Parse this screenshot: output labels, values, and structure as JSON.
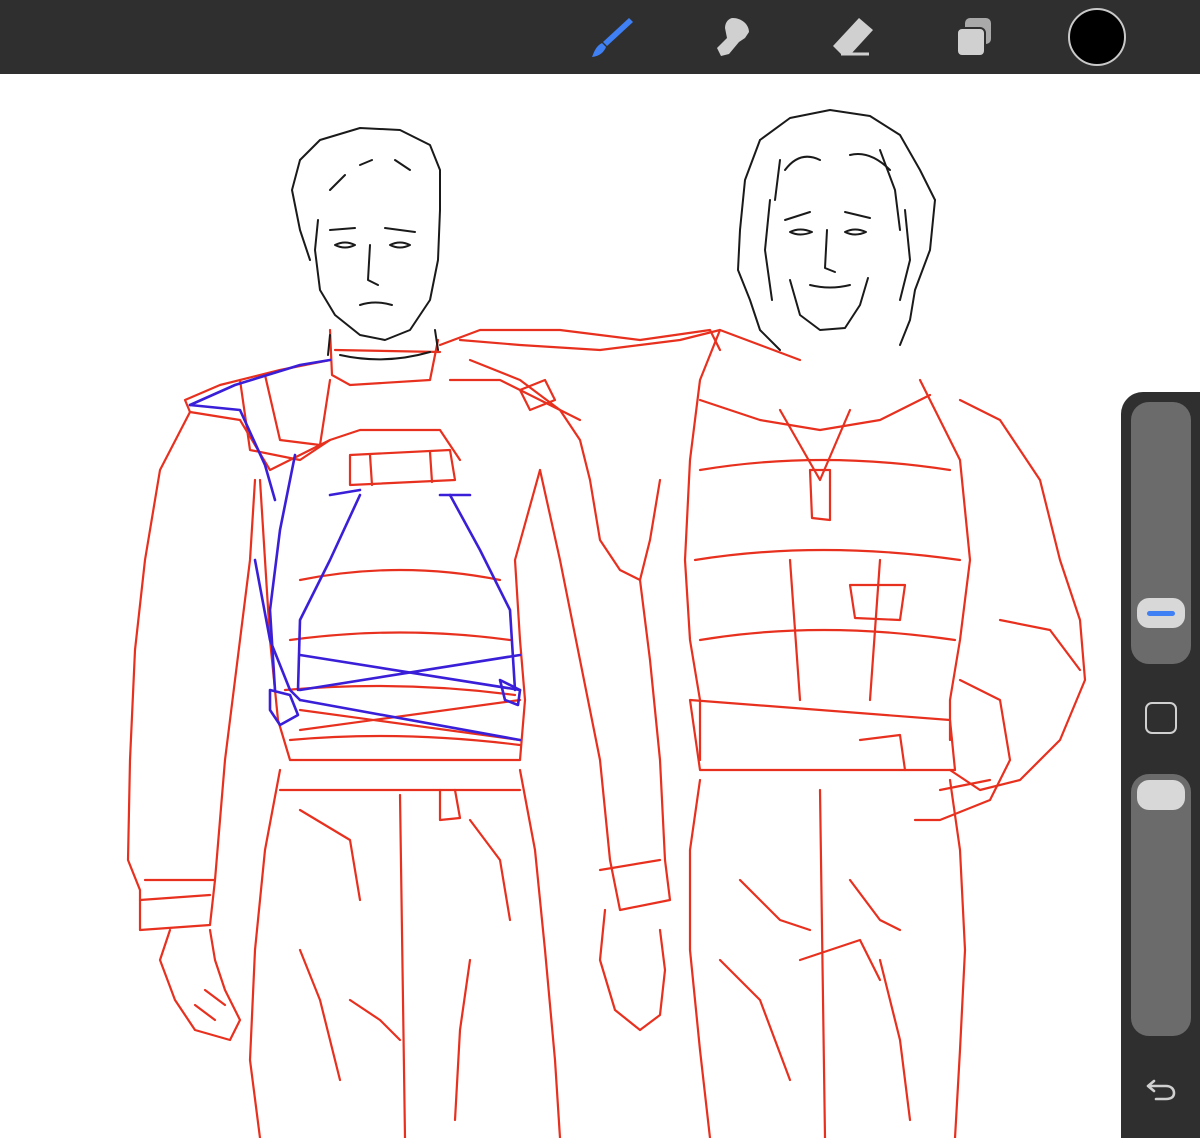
{
  "toolbar": {
    "tools": [
      {
        "name": "brush",
        "icon": "brush-icon",
        "active": true
      },
      {
        "name": "smudge",
        "icon": "smudge-icon",
        "active": false
      },
      {
        "name": "eraser",
        "icon": "eraser-icon",
        "active": false
      },
      {
        "name": "layers",
        "icon": "layers-icon",
        "active": false
      }
    ],
    "current_color": "#000000"
  },
  "colors": {
    "toolbar_bg": "#2f2f2f",
    "active_tool": "#3f80f5",
    "inactive_tool": "#d0d0d0",
    "sketch_red": "#e8301f",
    "sketch_blue": "#3a1fd8",
    "ink": "#1a1a1a"
  },
  "sidebar": {
    "brush_size_slider": {
      "icon": "size-slider-handle"
    },
    "modify_button": {
      "icon": "square-icon"
    },
    "opacity_slider": {
      "icon": "opacity-slider-handle"
    },
    "undo_button": {
      "icon": "undo-icon"
    }
  },
  "canvas": {
    "content": "sketch"
  }
}
